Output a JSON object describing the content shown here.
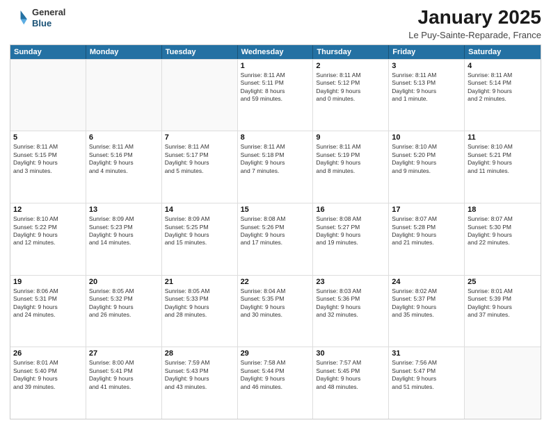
{
  "logo": {
    "general": "General",
    "blue": "Blue"
  },
  "header": {
    "title": "January 2025",
    "subtitle": "Le Puy-Sainte-Reparade, France"
  },
  "days": [
    "Sunday",
    "Monday",
    "Tuesday",
    "Wednesday",
    "Thursday",
    "Friday",
    "Saturday"
  ],
  "rows": [
    [
      {
        "day": "",
        "lines": []
      },
      {
        "day": "",
        "lines": []
      },
      {
        "day": "",
        "lines": []
      },
      {
        "day": "1",
        "lines": [
          "Sunrise: 8:11 AM",
          "Sunset: 5:11 PM",
          "Daylight: 8 hours",
          "and 59 minutes."
        ]
      },
      {
        "day": "2",
        "lines": [
          "Sunrise: 8:11 AM",
          "Sunset: 5:12 PM",
          "Daylight: 9 hours",
          "and 0 minutes."
        ]
      },
      {
        "day": "3",
        "lines": [
          "Sunrise: 8:11 AM",
          "Sunset: 5:13 PM",
          "Daylight: 9 hours",
          "and 1 minute."
        ]
      },
      {
        "day": "4",
        "lines": [
          "Sunrise: 8:11 AM",
          "Sunset: 5:14 PM",
          "Daylight: 9 hours",
          "and 2 minutes."
        ]
      }
    ],
    [
      {
        "day": "5",
        "lines": [
          "Sunrise: 8:11 AM",
          "Sunset: 5:15 PM",
          "Daylight: 9 hours",
          "and 3 minutes."
        ]
      },
      {
        "day": "6",
        "lines": [
          "Sunrise: 8:11 AM",
          "Sunset: 5:16 PM",
          "Daylight: 9 hours",
          "and 4 minutes."
        ]
      },
      {
        "day": "7",
        "lines": [
          "Sunrise: 8:11 AM",
          "Sunset: 5:17 PM",
          "Daylight: 9 hours",
          "and 5 minutes."
        ]
      },
      {
        "day": "8",
        "lines": [
          "Sunrise: 8:11 AM",
          "Sunset: 5:18 PM",
          "Daylight: 9 hours",
          "and 7 minutes."
        ]
      },
      {
        "day": "9",
        "lines": [
          "Sunrise: 8:11 AM",
          "Sunset: 5:19 PM",
          "Daylight: 9 hours",
          "and 8 minutes."
        ]
      },
      {
        "day": "10",
        "lines": [
          "Sunrise: 8:10 AM",
          "Sunset: 5:20 PM",
          "Daylight: 9 hours",
          "and 9 minutes."
        ]
      },
      {
        "day": "11",
        "lines": [
          "Sunrise: 8:10 AM",
          "Sunset: 5:21 PM",
          "Daylight: 9 hours",
          "and 11 minutes."
        ]
      }
    ],
    [
      {
        "day": "12",
        "lines": [
          "Sunrise: 8:10 AM",
          "Sunset: 5:22 PM",
          "Daylight: 9 hours",
          "and 12 minutes."
        ]
      },
      {
        "day": "13",
        "lines": [
          "Sunrise: 8:09 AM",
          "Sunset: 5:23 PM",
          "Daylight: 9 hours",
          "and 14 minutes."
        ]
      },
      {
        "day": "14",
        "lines": [
          "Sunrise: 8:09 AM",
          "Sunset: 5:25 PM",
          "Daylight: 9 hours",
          "and 15 minutes."
        ]
      },
      {
        "day": "15",
        "lines": [
          "Sunrise: 8:08 AM",
          "Sunset: 5:26 PM",
          "Daylight: 9 hours",
          "and 17 minutes."
        ]
      },
      {
        "day": "16",
        "lines": [
          "Sunrise: 8:08 AM",
          "Sunset: 5:27 PM",
          "Daylight: 9 hours",
          "and 19 minutes."
        ]
      },
      {
        "day": "17",
        "lines": [
          "Sunrise: 8:07 AM",
          "Sunset: 5:28 PM",
          "Daylight: 9 hours",
          "and 21 minutes."
        ]
      },
      {
        "day": "18",
        "lines": [
          "Sunrise: 8:07 AM",
          "Sunset: 5:30 PM",
          "Daylight: 9 hours",
          "and 22 minutes."
        ]
      }
    ],
    [
      {
        "day": "19",
        "lines": [
          "Sunrise: 8:06 AM",
          "Sunset: 5:31 PM",
          "Daylight: 9 hours",
          "and 24 minutes."
        ]
      },
      {
        "day": "20",
        "lines": [
          "Sunrise: 8:05 AM",
          "Sunset: 5:32 PM",
          "Daylight: 9 hours",
          "and 26 minutes."
        ]
      },
      {
        "day": "21",
        "lines": [
          "Sunrise: 8:05 AM",
          "Sunset: 5:33 PM",
          "Daylight: 9 hours",
          "and 28 minutes."
        ]
      },
      {
        "day": "22",
        "lines": [
          "Sunrise: 8:04 AM",
          "Sunset: 5:35 PM",
          "Daylight: 9 hours",
          "and 30 minutes."
        ]
      },
      {
        "day": "23",
        "lines": [
          "Sunrise: 8:03 AM",
          "Sunset: 5:36 PM",
          "Daylight: 9 hours",
          "and 32 minutes."
        ]
      },
      {
        "day": "24",
        "lines": [
          "Sunrise: 8:02 AM",
          "Sunset: 5:37 PM",
          "Daylight: 9 hours",
          "and 35 minutes."
        ]
      },
      {
        "day": "25",
        "lines": [
          "Sunrise: 8:01 AM",
          "Sunset: 5:39 PM",
          "Daylight: 9 hours",
          "and 37 minutes."
        ]
      }
    ],
    [
      {
        "day": "26",
        "lines": [
          "Sunrise: 8:01 AM",
          "Sunset: 5:40 PM",
          "Daylight: 9 hours",
          "and 39 minutes."
        ]
      },
      {
        "day": "27",
        "lines": [
          "Sunrise: 8:00 AM",
          "Sunset: 5:41 PM",
          "Daylight: 9 hours",
          "and 41 minutes."
        ]
      },
      {
        "day": "28",
        "lines": [
          "Sunrise: 7:59 AM",
          "Sunset: 5:43 PM",
          "Daylight: 9 hours",
          "and 43 minutes."
        ]
      },
      {
        "day": "29",
        "lines": [
          "Sunrise: 7:58 AM",
          "Sunset: 5:44 PM",
          "Daylight: 9 hours",
          "and 46 minutes."
        ]
      },
      {
        "day": "30",
        "lines": [
          "Sunrise: 7:57 AM",
          "Sunset: 5:45 PM",
          "Daylight: 9 hours",
          "and 48 minutes."
        ]
      },
      {
        "day": "31",
        "lines": [
          "Sunrise: 7:56 AM",
          "Sunset: 5:47 PM",
          "Daylight: 9 hours",
          "and 51 minutes."
        ]
      },
      {
        "day": "",
        "lines": []
      }
    ]
  ]
}
